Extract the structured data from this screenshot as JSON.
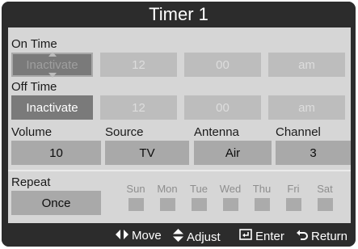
{
  "window": {
    "title": "Timer 1"
  },
  "on_time": {
    "label": "On Time",
    "activation": "Inactivate",
    "hour": "12",
    "minute": "00",
    "ampm": "am"
  },
  "off_time": {
    "label": "Off Time",
    "activation": "Inactivate",
    "hour": "12",
    "minute": "00",
    "ampm": "am"
  },
  "volume": {
    "label": "Volume",
    "value": "10"
  },
  "source": {
    "label": "Source",
    "value": "TV"
  },
  "antenna": {
    "label": "Antenna",
    "value": "Air"
  },
  "channel": {
    "label": "Channel",
    "value": "3"
  },
  "repeat": {
    "label": "Repeat",
    "value": "Once"
  },
  "days": [
    {
      "label": "Sun"
    },
    {
      "label": "Mon"
    },
    {
      "label": "Tue"
    },
    {
      "label": "Wed"
    },
    {
      "label": "Thu"
    },
    {
      "label": "Fri"
    },
    {
      "label": "Sat"
    }
  ],
  "footer": {
    "move": "Move",
    "move_icon": "left-right-arrows-icon",
    "adjust": "Adjust",
    "adjust_icon": "up-down-arrows-icon",
    "enter": "Enter",
    "enter_icon": "enter-icon",
    "return": "Return",
    "return_icon": "return-icon"
  },
  "colors": {
    "frame": "#2c2c2c",
    "panel": "#d6d6d6",
    "field": "#bdbdbd",
    "field_active": "#7a7a7a"
  }
}
